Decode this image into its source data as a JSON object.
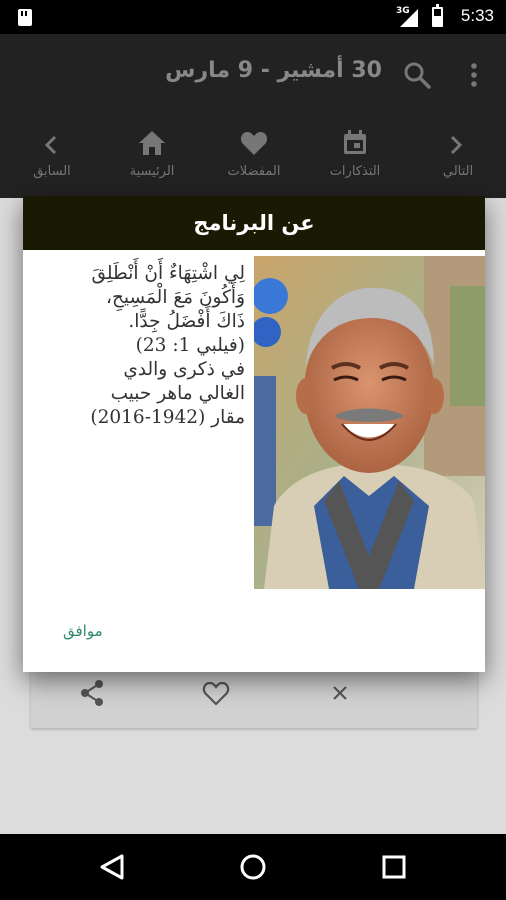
{
  "status_bar": {
    "network": "3G",
    "time": "5:33",
    "icons": [
      "sd-card-icon",
      "signal-icon",
      "battery-charging-icon"
    ]
  },
  "app_bar": {
    "title": "30 أمشير - 9 مارس",
    "icons": [
      "search-icon",
      "more-vert-icon"
    ]
  },
  "nav": {
    "next_label": "التالي",
    "reminders_label": "التذكارات",
    "favorites_label": "المفضلات",
    "home_label": "الرئيسية",
    "previous_label": "السابق"
  },
  "dialog": {
    "title": "عن البرنامج",
    "verse_line1": "لِي اشْتِهَاءٌ أَنْ أَنْطَلِقَ",
    "verse_line2": "وَأَكُونَ مَعَ الْمَسِيحِ،",
    "verse_line3": "ذَاكَ أَفْضَلُ جِدًّا.",
    "reference": "(فيلبي 1: 23)",
    "memorial_line1": "في ذكرى والدي",
    "memorial_line2": "الغالي ماهر حبيب",
    "memorial_line3": "مقار (1942-2016)",
    "ok_label": "موافق"
  },
  "card": {
    "icons": [
      "share-icon",
      "favorite-border-icon",
      "close-icon"
    ]
  },
  "colors": {
    "dialog_title_bg": "#1a1a04",
    "ok_text": "#2e8b6f",
    "app_bar_bg": "#222222",
    "scrim_bg": "#dcdcdc"
  }
}
